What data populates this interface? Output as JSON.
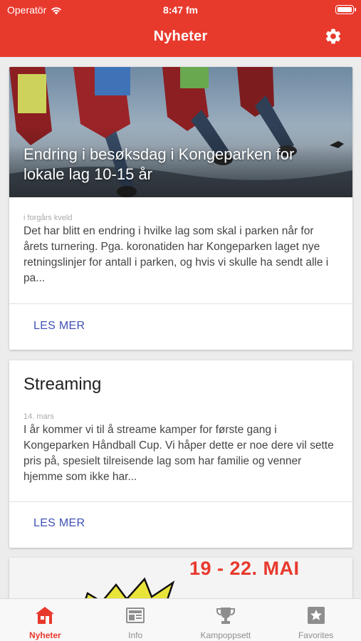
{
  "status_bar": {
    "carrier": "Operatör",
    "time": "8:47 fm"
  },
  "header": {
    "title": "Nyheter",
    "settings_icon": "gear-icon"
  },
  "news": [
    {
      "title": "Endring i besøksdag i Kongeparken for lokale lag 10-15 år",
      "date": "i forgårs kveld",
      "excerpt": "Det har blitt en endring i hvilke lag som skal i parken når for årets turnering. Pga. koronatiden har Kongeparken laget nye retningslinjer for antall i parken, og hvis vi skulle ha sendt alle i pa...",
      "button": "LES MER"
    },
    {
      "title": "Streaming",
      "date": "14. mars",
      "excerpt": "I år kommer vi til å streame kamper for første gang i Kongeparken Håndball Cup. Vi håper dette er noe dere vil sette pris på, spesielt tilreisende lag som har familie og venner hjemme som ikke har...",
      "button": "LES MER"
    },
    {
      "banner_text": "19 - 22. MAI"
    }
  ],
  "tabs": [
    {
      "label": "Nyheter",
      "icon": "home-icon",
      "active": true
    },
    {
      "label": "Info",
      "icon": "newspaper-icon",
      "active": false
    },
    {
      "label": "Kampoppsett",
      "icon": "trophy-icon",
      "active": false
    },
    {
      "label": "Favorites",
      "icon": "star-icon",
      "active": false
    }
  ],
  "colors": {
    "brand": "#e8392d",
    "button_text": "#3f51b5",
    "tab_inactive": "#8e8e8e"
  }
}
